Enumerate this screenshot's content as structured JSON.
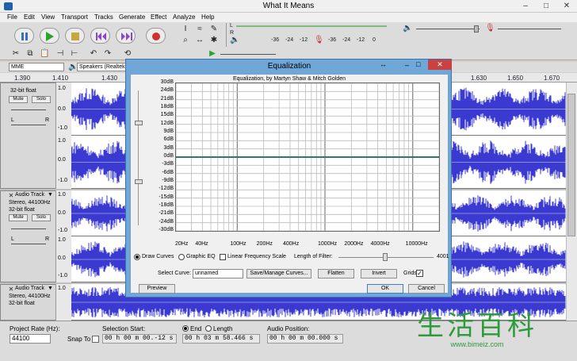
{
  "window": {
    "title": "What It Means",
    "minimize": "–",
    "maximize": "□",
    "close": "✕"
  },
  "menu": [
    "File",
    "Edit",
    "View",
    "Transport",
    "Tracks",
    "Generate",
    "Effect",
    "Analyze",
    "Help"
  ],
  "transport": [
    "pause",
    "play",
    "stop",
    "skip-start",
    "skip-end",
    "record"
  ],
  "meters": {
    "scale": [
      "-36",
      "-24",
      "-12",
      "0"
    ],
    "rec_scale": [
      "-36",
      "-24",
      "-12",
      "0"
    ],
    "left": "L",
    "right": "R"
  },
  "devices": {
    "host": "MME",
    "output": "Speakers (Realtek"
  },
  "ruler": {
    "left": [
      "1.390",
      "1.410",
      "1.430"
    ],
    "right": [
      "1.630",
      "1.650",
      "1.670"
    ]
  },
  "tracks": [
    {
      "name": "",
      "info": "32-bit float",
      "mute": "Mute",
      "solo": "Solo",
      "lr": [
        "L",
        "R"
      ],
      "scale": [
        "1.0",
        "0.0",
        "-1.0",
        "1.0",
        "0.0",
        "-1.0"
      ]
    },
    {
      "name": "Audio Track",
      "info": "Stereo, 44100Hz",
      "info2": "32-bit float",
      "mute": "Mute",
      "solo": "Solo",
      "lr": [
        "L",
        "R"
      ],
      "scale": [
        "1.0",
        "0.0",
        "-1.0",
        "1.0",
        "0.0",
        "-1.0"
      ]
    },
    {
      "name": "Audio Track",
      "info": "Stereo, 44100Hz",
      "info2": "32-bit float",
      "scale": [
        "1.0"
      ]
    }
  ],
  "bottom": {
    "rate_label": "Project Rate (Hz):",
    "rate_value": "44100",
    "snap_label": "Snap To",
    "sel_start_label": "Selection Start:",
    "end_label": "End",
    "length_label": "Length",
    "audio_pos_label": "Audio Position:",
    "sel_start": "00 h 00 m 00.-12 s",
    "end_value": "00 h 03 m 58.466 s",
    "audio_pos": "00 h 00 m 00.000 s"
  },
  "dialog": {
    "title": "Equalization",
    "heading": "Equalization, by Martyn Shaw & Mitch Golden",
    "db_labels": [
      "30dB",
      "24dB",
      "21dB",
      "18dB",
      "15dB",
      "12dB",
      "9dB",
      "6dB",
      "3dB",
      "0dB",
      "-3dB",
      "-6dB",
      "-9dB",
      "-12dB",
      "-15dB",
      "-18dB",
      "-21dB",
      "-24dB",
      "-30dB"
    ],
    "freq_labels": [
      "20Hz",
      "40Hz",
      "100Hz",
      "200Hz",
      "400Hz",
      "1000Hz",
      "2000Hz",
      "4000Hz",
      "10000Hz"
    ],
    "curve_db": 0,
    "draw_curves": "Draw Curves",
    "graphic_eq": "Graphic EQ",
    "linear_freq": "Linear Frequency Scale",
    "filter_label": "Length of Filter:",
    "filter_value": "4001",
    "select_curve_label": "Select Curve:",
    "curve_value": "unnamed",
    "save_manage": "Save/Manage Curves...",
    "flatten": "Flatten",
    "invert": "Invert",
    "grids": "Grids",
    "preview": "Preview",
    "ok": "OK",
    "cancel": "Cancel"
  },
  "watermark": {
    "cn": "生活百科",
    "url": "www.bimeiz.com"
  },
  "colors": {
    "wave": "#3a3ad0",
    "curve": "#2c7a6c",
    "dialog_border": "#6fa7d8"
  }
}
